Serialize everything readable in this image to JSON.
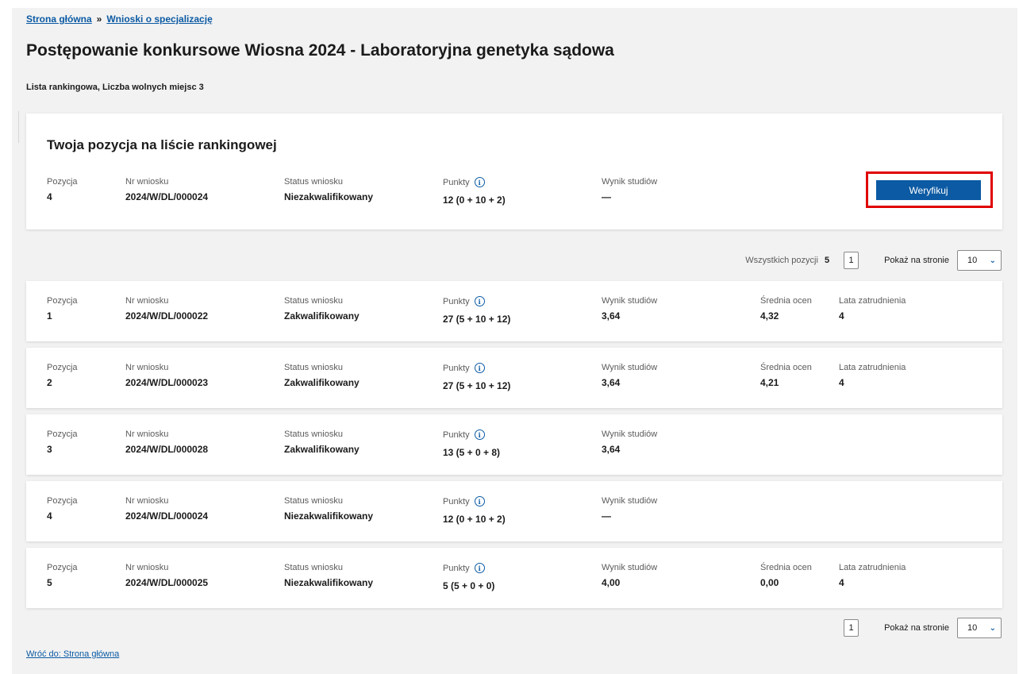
{
  "breadcrumb": {
    "home": "Strona główna",
    "separator": "»",
    "current": "Wnioski o specjalizację"
  },
  "title": "Postępowanie konkursowe Wiosna 2024 - Laboratoryjna genetyka sądowa",
  "subtitle": "Lista rankingowa, Liczba wolnych miejsc 3",
  "labels": {
    "pozycja": "Pozycja",
    "nr_wniosku": "Nr wniosku",
    "status": "Status wniosku",
    "punkty": "Punkty",
    "wynik": "Wynik studiów",
    "srednia": "Średnia ocen",
    "lata": "Lata zatrudnienia"
  },
  "my_position": {
    "heading": "Twoja pozycja na liście rankingowej",
    "pozycja": "4",
    "nr": "2024/W/DL/000024",
    "status": "Niezakwalifikowany",
    "punkty": "12 (0 + 10 + 2)",
    "wynik": "—",
    "button": "Weryfikuj"
  },
  "pager": {
    "total_label": "Wszystkich pozycji",
    "total": "5",
    "page": "1",
    "per_page_label": "Pokaż na stronie",
    "per_page": "10"
  },
  "rows": [
    {
      "pozycja": "1",
      "nr": "2024/W/DL/000022",
      "status": "Zakwalifikowany",
      "punkty": "27 (5 + 10 + 12)",
      "wynik": "3,64",
      "srednia": "4,32",
      "lata": "4"
    },
    {
      "pozycja": "2",
      "nr": "2024/W/DL/000023",
      "status": "Zakwalifikowany",
      "punkty": "27 (5 + 10 + 12)",
      "wynik": "3,64",
      "srednia": "4,21",
      "lata": "4"
    },
    {
      "pozycja": "3",
      "nr": "2024/W/DL/000028",
      "status": "Zakwalifikowany",
      "punkty": "13 (5 + 0 + 8)",
      "wynik": "3,64"
    },
    {
      "pozycja": "4",
      "nr": "2024/W/DL/000024",
      "status": "Niezakwalifikowany",
      "punkty": "12 (0 + 10 + 2)",
      "wynik": "—"
    },
    {
      "pozycja": "5",
      "nr": "2024/W/DL/000025",
      "status": "Niezakwalifikowany",
      "punkty": "5 (5 + 0 + 0)",
      "wynik": "4,00",
      "srednia": "0,00",
      "lata": "4"
    }
  ],
  "back_link": "Wróć do: Strona główna",
  "colors": {
    "accent": "#0b5aa3",
    "highlight": "#e00000",
    "background": "#f2f2f2"
  },
  "icons": {
    "info": "info-circle-icon",
    "dropdown": "chevron-down-icon"
  }
}
